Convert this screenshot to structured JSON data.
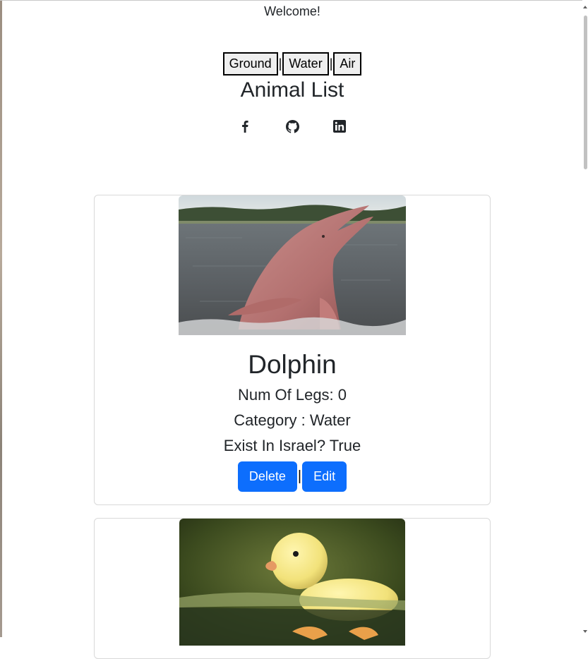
{
  "header": {
    "welcome": "Welcome!",
    "nav": [
      {
        "label": "Ground"
      },
      {
        "label": "Water"
      },
      {
        "label": "Air"
      }
    ],
    "nav_separator": "|",
    "title": "Animal List",
    "social_icons": [
      "facebook-icon",
      "github-icon",
      "linkedin-icon"
    ]
  },
  "animals": [
    {
      "name": "Dolphin",
      "legs": "Num Of Legs: 0",
      "category": "Category : Water",
      "exist_in_israel": "Exist In Israel? True",
      "image": "pink river dolphin leaping from water",
      "actions": {
        "delete": "Delete",
        "separator": "|",
        "edit": "Edit"
      }
    },
    {
      "image": "yellow duckling swimming in water"
    }
  ],
  "colors": {
    "primary": "#0d6efd",
    "text": "#212529",
    "card_border": "#d9d9d9"
  }
}
